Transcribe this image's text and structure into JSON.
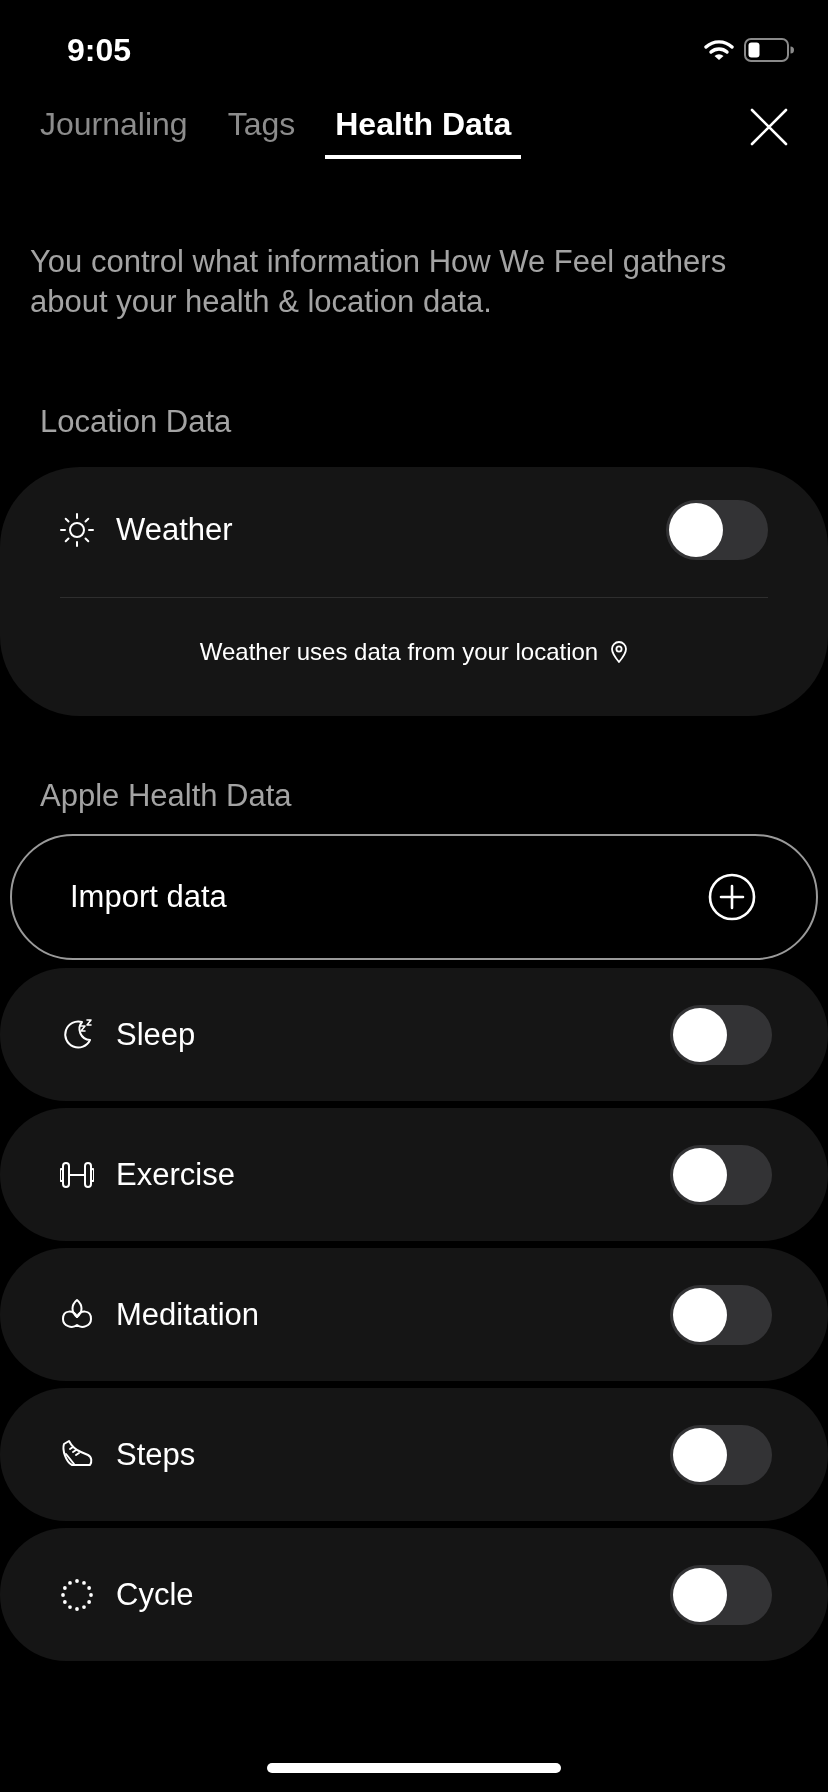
{
  "status_bar": {
    "time": "9:05"
  },
  "tabs": [
    {
      "label": "Journaling",
      "selected": false
    },
    {
      "label": "Tags",
      "selected": false
    },
    {
      "label": "Health Data",
      "selected": true
    }
  ],
  "intro": "You control what information How We Feel gathers about your health & location data.",
  "location": {
    "heading": "Location Data",
    "toggle": {
      "label": "Weather",
      "on": false
    },
    "note": "Weather uses data from your location"
  },
  "health": {
    "heading": "Apple Health Data",
    "import_button": "Import data",
    "items": [
      {
        "label": "Sleep",
        "on": false
      },
      {
        "label": "Exercise",
        "on": false
      },
      {
        "label": "Meditation",
        "on": false
      },
      {
        "label": "Steps",
        "on": false
      },
      {
        "label": "Cycle",
        "on": false
      }
    ]
  }
}
